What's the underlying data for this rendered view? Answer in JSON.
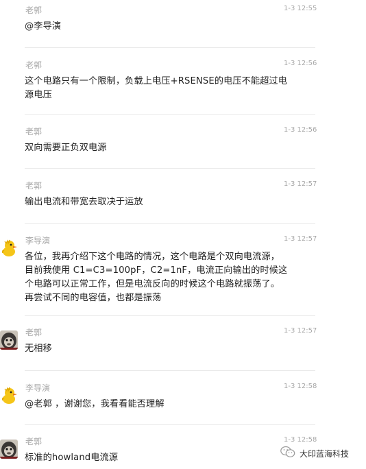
{
  "messages": [
    {
      "sender": "老郭",
      "time": "1-3 12:55",
      "avatar": "none",
      "lines": [
        "@李导演"
      ]
    },
    {
      "sender": "老郭",
      "time": "1-3 12:56",
      "avatar": "none",
      "lines": [
        "这个电路只有一个限制，负载上电压+RSENSE的电压不能超过电",
        "源电压"
      ]
    },
    {
      "sender": "老郭",
      "time": "1-3 12:56",
      "avatar": "none",
      "lines": [
        "双向需要正负双电源"
      ]
    },
    {
      "sender": "老郭",
      "time": "1-3 12:57",
      "avatar": "none",
      "lines": [
        "输出电流和带宽去取决于运放"
      ]
    },
    {
      "sender": "李导演",
      "time": "1-3 12:57",
      "avatar": "duck-avatar",
      "lines": [
        "各位，我再介绍下这个电路的情况，这个电路是个双向电流源，",
        "目前我使用 C1=C3=100pF，C2=1nF，电流正向输出的时候这",
        "个电路可以正常工作，但是电流反向的时候这个电路就振荡了。",
        "再尝试不同的电容值，也都是振荡"
      ]
    },
    {
      "sender": "老郭",
      "time": "1-3 12:57",
      "avatar": "gorilla-avatar",
      "lines": [
        "无相移"
      ]
    },
    {
      "sender": "李导演",
      "time": "1-3 12:58",
      "avatar": "duck-avatar",
      "lines": [
        "@老郭 ，谢谢您，我看看能否理解"
      ]
    },
    {
      "sender": "老郭",
      "time": "1-3 12:58",
      "avatar": "gorilla-avatar",
      "lines": [
        "标准的howland电流源"
      ]
    }
  ],
  "watermark": {
    "text": "大印蓝海科技",
    "icon": "wechat-channel-icon"
  }
}
